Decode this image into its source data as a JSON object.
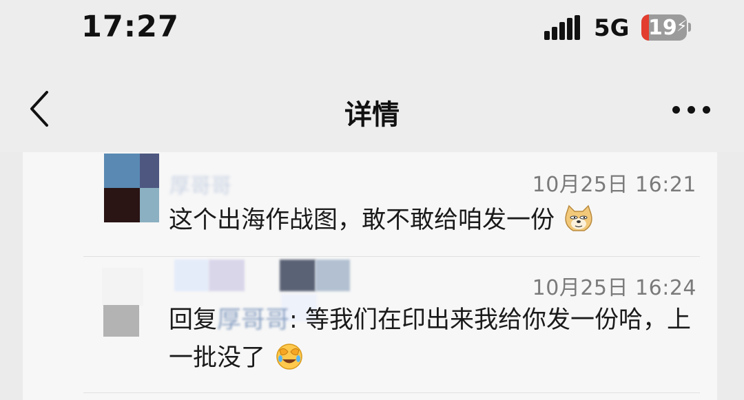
{
  "status_bar": {
    "time": "17:27",
    "network": "5G",
    "battery_level": "19",
    "battery_color": "#e23d2e"
  },
  "nav": {
    "back_icon": "chevron-left-icon",
    "title": "详情",
    "more_icon": "more-dots-icon"
  },
  "comments": [
    {
      "author": "厚哥哥",
      "timestamp": "10月25日 16:21",
      "text": "这个出海作战图，敢不敢给咱发一份",
      "emoji": "doge-emoji-icon"
    },
    {
      "author": "",
      "timestamp": "10月25日 16:24",
      "reply_prefix": "回复",
      "reply_to": "厚哥哥",
      "reply_sep": ": ",
      "text": "等我们在印出来我给你发一份哈，上一批没了",
      "emoji": "facepalm-laugh-emoji-icon"
    }
  ]
}
